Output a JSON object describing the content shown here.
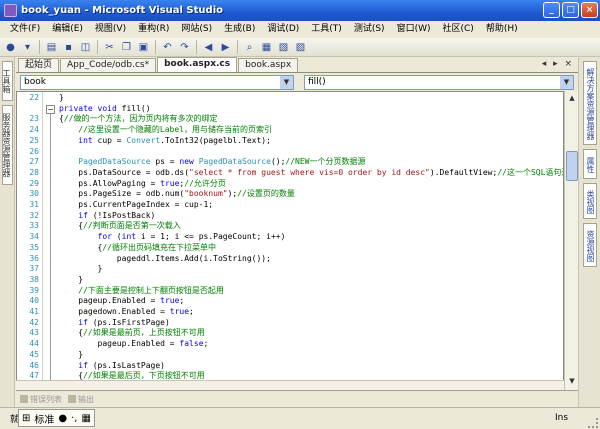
{
  "window": {
    "title": "book_yuan - Microsoft Visual Studio"
  },
  "menu": [
    "文件(F)",
    "编辑(E)",
    "视图(V)",
    "重构(R)",
    "网站(S)",
    "生成(B)",
    "调试(D)",
    "工具(T)",
    "测试(S)",
    "窗口(W)",
    "社区(C)",
    "帮助(H)"
  ],
  "tabs": [
    {
      "label": "起始页",
      "active": false
    },
    {
      "label": "App_Code/odb.cs*",
      "active": false
    },
    {
      "label": "book.aspx.cs",
      "active": true
    },
    {
      "label": "book.aspx",
      "active": false
    }
  ],
  "tab_controls": "◂ ▸ ×",
  "nav": {
    "class_combo": "book",
    "member_combo": "fill()"
  },
  "code_lines": [
    {
      "n": "22",
      "text": "}",
      "fold": false
    },
    {
      "n": "",
      "text": "private void fill()",
      "fold": true
    },
    {
      "n": "23",
      "text": "{//做的一个方法，因为页内将有多次的绑定",
      "fold": false
    },
    {
      "n": "24",
      "text": "    //这里设置一个隐藏的Label，用与储存当前的页索引",
      "fold": false
    },
    {
      "n": "25",
      "text": "    int cup = Convert.ToInt32(pagelbl.Text);",
      "fold": false
    },
    {
      "n": "26",
      "text": "",
      "fold": false
    },
    {
      "n": "27",
      "text": "    PagedDataSource ps = new PagedDataSource();//NEW一个分页数据源",
      "fold": false
    },
    {
      "n": "28",
      "text": "    ps.DataSource = odb.ds(\"select * from guest where vis=0 order by id desc\").DefaultView;//这一个SQL语句进",
      "fold": false
    },
    {
      "n": "29",
      "text": "    ps.AllowPaging = true;//允许分页",
      "fold": false
    },
    {
      "n": "30",
      "text": "    ps.PageSize = odb.num(\"booknum\");//设置页的数量",
      "fold": false
    },
    {
      "n": "31",
      "text": "    ps.CurrentPageIndex = cup-1;",
      "fold": false
    },
    {
      "n": "32",
      "text": "    if (!IsPostBack)",
      "fold": false
    },
    {
      "n": "33",
      "text": "    {//判断页面是否第一次载入",
      "fold": false
    },
    {
      "n": "34",
      "text": "        for (int i = 1; i <= ps.PageCount; i++)",
      "fold": false
    },
    {
      "n": "35",
      "text": "        {//循环出页码填充在下拉菜单中",
      "fold": false
    },
    {
      "n": "36",
      "text": "            pageddl.Items.Add(i.ToString());",
      "fold": false
    },
    {
      "n": "37",
      "text": "        }",
      "fold": false
    },
    {
      "n": "38",
      "text": "    }",
      "fold": false
    },
    {
      "n": "39",
      "text": "    //下面主要是控制上下翻页按钮是否起用",
      "fold": false
    },
    {
      "n": "40",
      "text": "    pageup.Enabled = true;",
      "fold": false
    },
    {
      "n": "41",
      "text": "    pagedown.Enabled = true;",
      "fold": false
    },
    {
      "n": "42",
      "text": "    if (ps.IsFirstPage)",
      "fold": false
    },
    {
      "n": "43",
      "text": "    {//如果是最前页，上页按钮不可用",
      "fold": false
    },
    {
      "n": "44",
      "text": "        pageup.Enabled = false;",
      "fold": false
    },
    {
      "n": "45",
      "text": "    }",
      "fold": false
    },
    {
      "n": "46",
      "text": "    if (ps.IsLastPage)",
      "fold": false
    },
    {
      "n": "47",
      "text": "    {//如果是最后页，下页按钮不可用",
      "fold": false
    },
    {
      "n": "48",
      "text": "        pagedown.Enabled = false;",
      "fold": false
    },
    {
      "n": "49",
      "text": "    }",
      "fold": false
    },
    {
      "n": "50",
      "text": "    //设置页码下拉菜单当前选中的值",
      "fold": false
    },
    {
      "n": "51",
      "text": "",
      "fold": false
    }
  ],
  "output_tabs": [
    "错误列表",
    "输出"
  ],
  "status": {
    "ready": "就",
    "ime_label": "标准",
    "ins": "Ins"
  },
  "left_panel_labels": [
    "工具箱",
    "服务器资源管理器"
  ],
  "right_panel_labels": [
    "解决方案资源管理器",
    "属性",
    "类视图",
    "资源视图"
  ],
  "colors": {
    "keyword": "#0000ff",
    "comment": "#008000",
    "string": "#a31515",
    "type": "#2b91af"
  },
  "icons": [
    "app-icon",
    "new-project-icon",
    "open-icon",
    "save-icon",
    "save-all-icon",
    "cut-icon",
    "copy-icon",
    "paste-icon",
    "undo-icon",
    "redo-icon",
    "start-debug-icon",
    "find-icon"
  ]
}
